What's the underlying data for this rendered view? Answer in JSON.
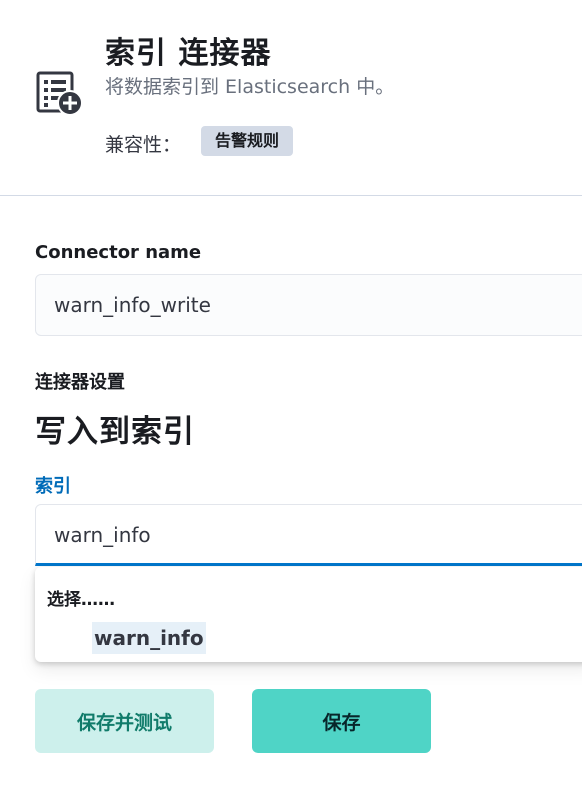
{
  "header": {
    "title": "索引 连接器",
    "subtitle": "将数据索引到 Elasticsearch 中。",
    "compat_label": "兼容性：",
    "compat_badge": "告警规则",
    "icon": "index-connector-icon"
  },
  "form": {
    "connector_name_label": "Connector name",
    "connector_name_value": "warn_info_write",
    "settings_label": "连接器设置",
    "section_title": "写入到索引",
    "index_label": "索引",
    "index_value": "warn_info",
    "dropdown": {
      "header": "选择……",
      "options": [
        "warn_info"
      ]
    }
  },
  "buttons": {
    "save_and_test": "保存并测试",
    "save": "保存"
  },
  "colors": {
    "accent_blue": "#0077cc",
    "primary_button": "#4fd4c6",
    "secondary_button": "#cdf0ec"
  }
}
